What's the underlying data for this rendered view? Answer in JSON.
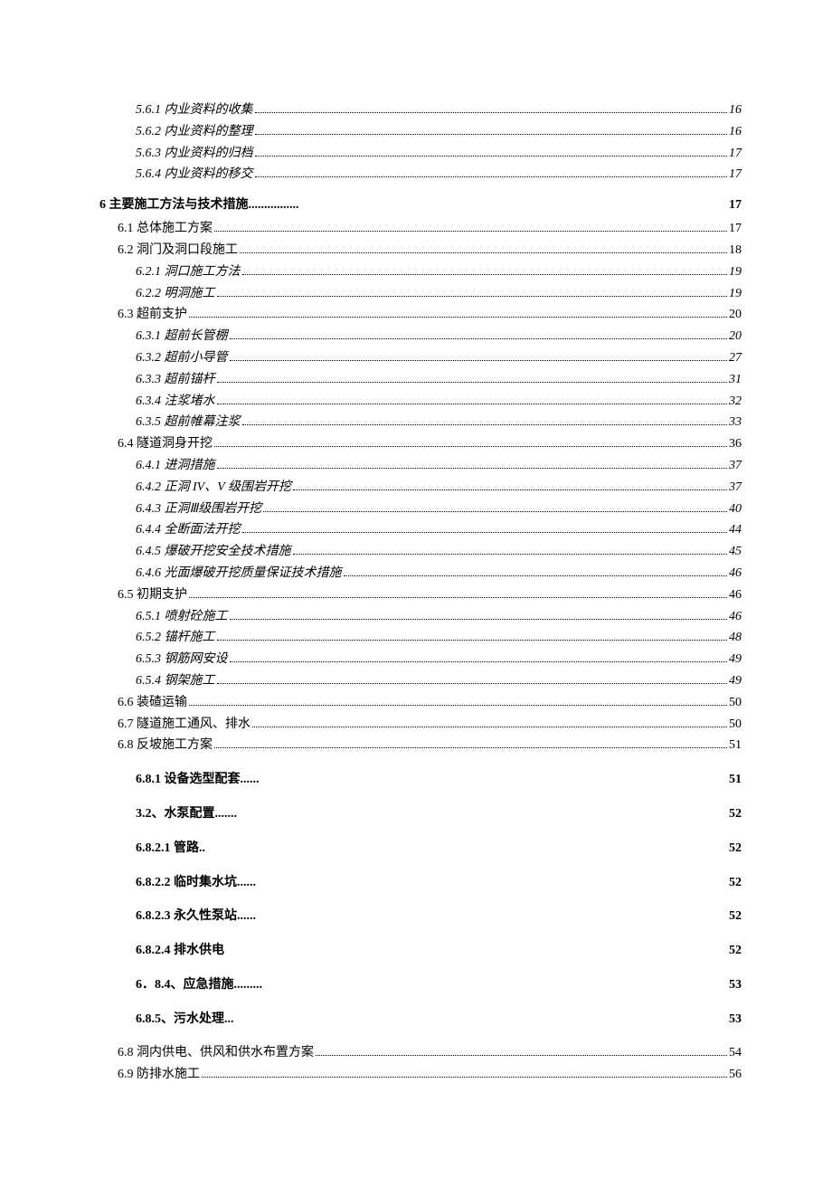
{
  "toc": [
    {
      "label": "5.6.1 内业资料的收集",
      "page": "16",
      "level": 2,
      "italic": true,
      "style": "dots",
      "bold": false
    },
    {
      "label": "5.6.2 内业资料的整理",
      "page": "16",
      "level": 2,
      "italic": true,
      "style": "dots",
      "bold": false
    },
    {
      "label": "5.6.3 内业资料的归档",
      "page": "17",
      "level": 2,
      "italic": true,
      "style": "dots",
      "bold": false
    },
    {
      "label": "5.6.4 内业资料的移交",
      "page": "17",
      "level": 2,
      "italic": true,
      "style": "dots",
      "bold": false
    },
    {
      "label": "6 主要施工方法与技术措施",
      "trail": "................",
      "page": "17",
      "level": 0,
      "style": "head",
      "bold": true
    },
    {
      "label": "6.1 总体施工方案",
      "page": "17",
      "level": 1,
      "italic": false,
      "style": "dots",
      "bold": false
    },
    {
      "label": "6.2 洞门及洞口段施工",
      "page": "18",
      "level": 1,
      "italic": false,
      "style": "dots",
      "bold": false
    },
    {
      "label": "6.2.1 洞口施工方法",
      "page": "19",
      "level": 2,
      "italic": true,
      "style": "dots",
      "bold": false
    },
    {
      "label": "6.2.2 明洞施工",
      "page": "19",
      "level": 2,
      "italic": true,
      "style": "dots",
      "bold": false
    },
    {
      "label": "6.3 超前支护",
      "page": "20",
      "level": 1,
      "italic": false,
      "style": "dots",
      "bold": false
    },
    {
      "label": "6.3.1 超前长管棚",
      "page": "20",
      "level": 2,
      "italic": true,
      "style": "dots",
      "bold": false
    },
    {
      "label": "6.3.2 超前小导管",
      "page": "27",
      "level": 2,
      "italic": true,
      "style": "dots",
      "bold": false
    },
    {
      "label": "6.3.3 超前锚杆",
      "page": "31",
      "level": 2,
      "italic": true,
      "style": "dots",
      "bold": false
    },
    {
      "label": "6.3.4 注浆堵水",
      "page": "32",
      "level": 2,
      "italic": true,
      "style": "dots",
      "bold": false
    },
    {
      "label": "6.3.5 超前帷幕注浆",
      "page": "33",
      "level": 2,
      "italic": true,
      "style": "dots",
      "bold": false
    },
    {
      "label": "6.4 隧道洞身开挖",
      "page": "36",
      "level": 1,
      "italic": false,
      "style": "dots",
      "bold": false
    },
    {
      "label": "6.4.1 进洞措施",
      "page": "37",
      "level": 2,
      "italic": true,
      "style": "dots",
      "bold": false
    },
    {
      "label": "6.4.2 正洞 IV、V 级围岩开挖",
      "page": "37",
      "level": 2,
      "italic": true,
      "style": "dots",
      "bold": false
    },
    {
      "label": "6.4.3 正洞Ⅲ级围岩开挖",
      "page": "40",
      "level": 2,
      "italic": true,
      "style": "dots",
      "bold": false
    },
    {
      "label": "6.4.4 全断面法开挖",
      "page": "44",
      "level": 2,
      "italic": true,
      "style": "dots",
      "bold": false
    },
    {
      "label": "6.4.5 爆破开挖安全技术措施",
      "page": "45",
      "level": 2,
      "italic": true,
      "style": "dots",
      "bold": false
    },
    {
      "label": "6.4.6 光面爆破开挖质量保证技术措施",
      "page": "46",
      "level": 2,
      "italic": true,
      "style": "dots",
      "bold": false
    },
    {
      "label": "6.5 初期支护",
      "page": "46",
      "level": 1,
      "italic": false,
      "style": "dots",
      "bold": false
    },
    {
      "label": "6.5.1 喷射砼施工",
      "page": "46",
      "level": 2,
      "italic": true,
      "style": "dots",
      "bold": false
    },
    {
      "label": "6.5.2 锚杆施工",
      "page": "48",
      "level": 2,
      "italic": true,
      "style": "dots",
      "bold": false
    },
    {
      "label": "6.5.3 钢筋网安设",
      "page": "49",
      "level": 2,
      "italic": true,
      "style": "dots",
      "bold": false
    },
    {
      "label": "6.5.4 钢架施工",
      "page": "49",
      "level": 2,
      "italic": true,
      "style": "dots",
      "bold": false
    },
    {
      "label": "6.6 装碴运输",
      "page": "50",
      "level": 1,
      "italic": false,
      "style": "dots",
      "bold": false
    },
    {
      "label": "6.7 隧道施工通风、排水",
      "page": "50",
      "level": 1,
      "italic": false,
      "style": "dots",
      "bold": false
    },
    {
      "label": "6.8 反坡施工方案",
      "page": "51",
      "level": 1,
      "italic": false,
      "style": "dots",
      "bold": false
    },
    {
      "label": "6.8.1 设备选型配套",
      "trail": "......",
      "page": "51",
      "level": 2,
      "style": "short",
      "bold": true
    },
    {
      "label": "3.2、水泵配置",
      "trail": ".......",
      "page": "52",
      "level": 2,
      "style": "short",
      "bold": true
    },
    {
      "label": "6.8.2.1 管路",
      "trail": "..",
      "page": "52",
      "level": 2,
      "style": "short",
      "bold": true
    },
    {
      "label": "6.8.2.2 临时集水坑",
      "trail": "......",
      "page": "52",
      "level": 2,
      "style": "short",
      "bold": true
    },
    {
      "label": "6.8.2.3 永久性泵站",
      "trail": "......",
      "page": "52",
      "level": 2,
      "style": "short",
      "bold": true
    },
    {
      "label": "6.8.2.4 排水供电",
      "trail": "",
      "page": "52",
      "level": 2,
      "style": "short",
      "bold": true
    },
    {
      "label": "6．8.4、应急措施",
      "trail": ".........",
      "page": "53",
      "level": 2,
      "style": "short",
      "bold": true
    },
    {
      "label": "6.8.5、污水处理",
      "trail": "...",
      "page": "53",
      "level": 2,
      "style": "short",
      "bold": true
    },
    {
      "label": "6.8 洞内供电、供风和供水布置方案",
      "page": "54",
      "level": 1,
      "italic": false,
      "style": "dots",
      "bold": false
    },
    {
      "label": "6.9 防排水施工",
      "page": "56",
      "level": 1,
      "italic": false,
      "style": "dots",
      "bold": false
    }
  ]
}
